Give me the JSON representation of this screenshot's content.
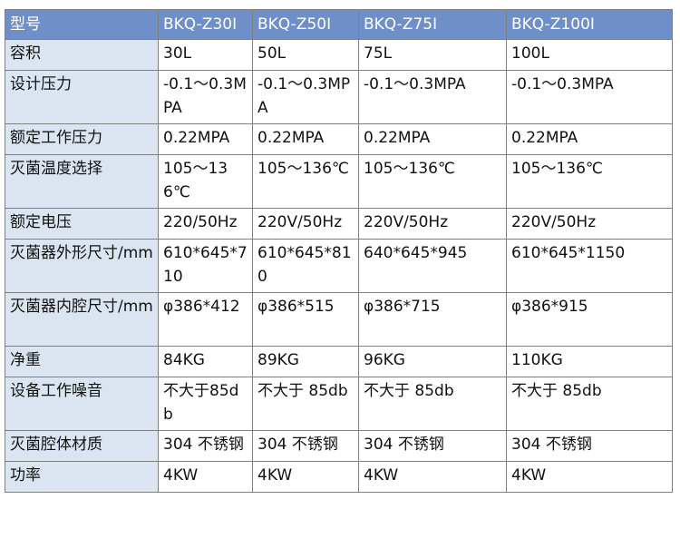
{
  "table": {
    "header": {
      "label": "型号",
      "models": [
        "BKQ-Z30I",
        "BKQ-Z50I",
        "BKQ-Z75I",
        "BKQ-Z100I"
      ]
    },
    "rows": [
      {
        "label": "容积",
        "values": [
          "30L",
          "50L",
          "75L",
          "100L"
        ]
      },
      {
        "label": "设计压力",
        "values": [
          "-0.1～0.3MPA",
          "-0.1～0.3MPA",
          "-0.1～0.3MPA",
          "-0.1～0.3MPA"
        ]
      },
      {
        "label": "额定工作压力",
        "values": [
          "0.22MPA",
          "0.22MPA",
          "0.22MPA",
          "0.22MPA"
        ]
      },
      {
        "label": "灭菌温度选择",
        "values": [
          "105～136℃",
          "105～136℃",
          "105～136℃",
          "105～136℃"
        ]
      },
      {
        "label": "额定电压",
        "values": [
          "220/50Hz",
          "220V/50Hz",
          "220V/50Hz",
          "220V/50Hz"
        ]
      },
      {
        "label": "灭菌器外形尺寸/mm",
        "values": [
          "610*645*710",
          "610*645*810",
          "640*645*945",
          "610*645*1150"
        ]
      },
      {
        "label": "灭菌器内腔尺寸/mm",
        "values": [
          "φ386*412",
          "φ386*515",
          "φ386*715",
          "φ386*915"
        ]
      },
      {
        "label": "净重",
        "values": [
          "84KG",
          "89KG",
          "96KG",
          "110KG"
        ]
      },
      {
        "label": "设备工作噪音",
        "values": [
          "不大于85db",
          "不大于 85db",
          "不大于 85db",
          "不大于 85db"
        ]
      },
      {
        "label": "灭菌腔体材质",
        "values": [
          "304 不锈钢",
          "304 不锈钢",
          "304 不锈钢",
          "304 不锈钢"
        ]
      },
      {
        "label": "功率",
        "values": [
          "4KW",
          "4KW",
          "4KW",
          "4KW"
        ]
      }
    ]
  },
  "colors": {
    "header_bg": "#6f8fc9",
    "label_bg": "#dbe5f1",
    "border": "#7f7f7f"
  }
}
